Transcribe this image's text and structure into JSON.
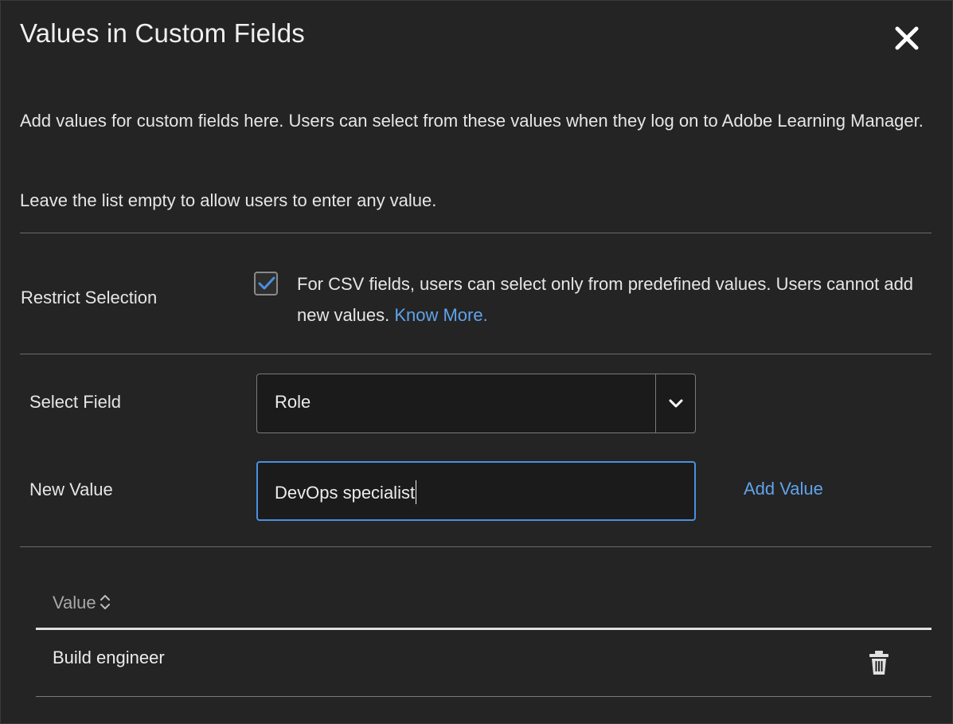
{
  "dialog": {
    "title": "Values in Custom Fields",
    "close_icon": "close-icon"
  },
  "intro": {
    "description": "Add values for custom fields here. Users can select from these values when they log on to Adobe Learning Manager.",
    "hint": "Leave the list empty to allow users to enter any value."
  },
  "restrict": {
    "label": "Restrict Selection",
    "checked": true,
    "text": "For CSV fields, users can select only from predefined values. Users cannot add new values.",
    "link": "Know More."
  },
  "select_field": {
    "label": "Select Field",
    "value": "Role",
    "icon": "chevron-down-icon"
  },
  "new_value": {
    "label": "New Value",
    "value": "DevOps specialist",
    "add_label": "Add Value"
  },
  "table": {
    "column_header": "Value",
    "sort_icon": "sort-icon",
    "rows": [
      {
        "value": "Build engineer",
        "action_icon": "trash-icon"
      }
    ]
  },
  "colors": {
    "background": "#242424",
    "accent": "#5fa3ea",
    "focus_border": "#4b8fdf"
  }
}
